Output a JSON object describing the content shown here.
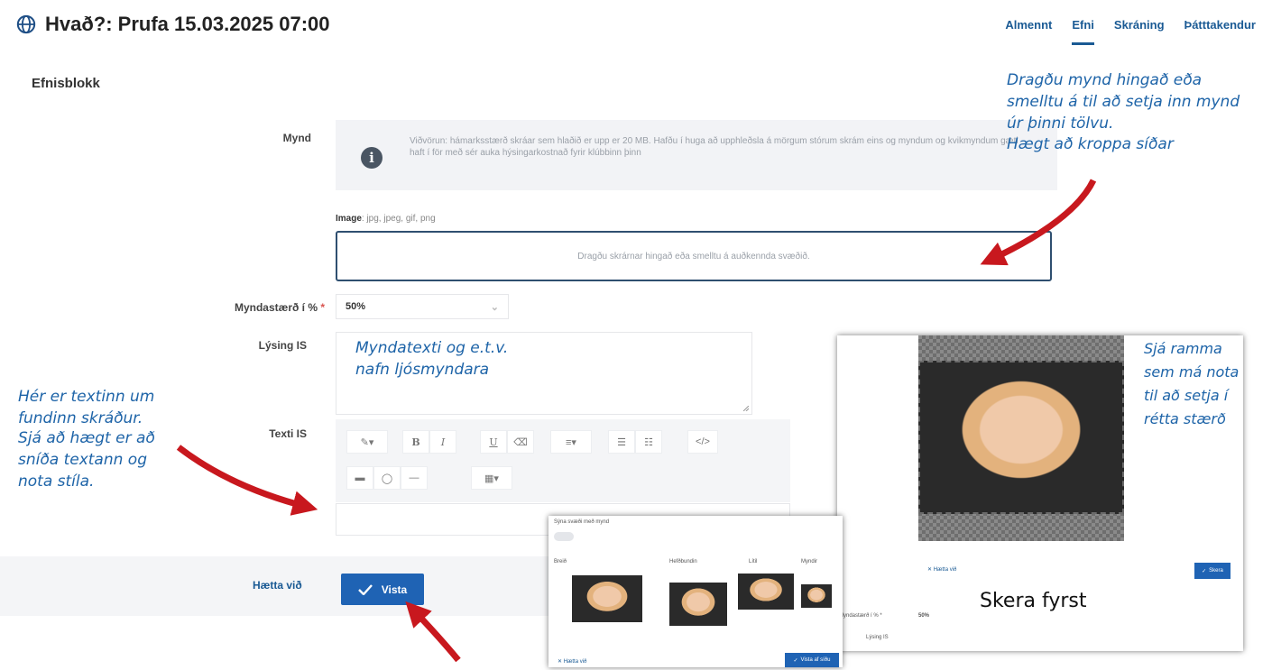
{
  "header": {
    "title": "Hvað?: Prufa 15.03.2025 07:00",
    "tabs": [
      {
        "label": "Almennt",
        "active": false
      },
      {
        "label": "Efni",
        "active": true
      },
      {
        "label": "Skráning",
        "active": false
      },
      {
        "label": "Þátttakendur",
        "active": false
      }
    ]
  },
  "section": {
    "title": "Efnisblokk"
  },
  "form": {
    "image_label": "Mynd",
    "info_text": "Viðvörun: hámarksstærð skráar sem hlaðið er upp er 20 MB. Hafðu í huga að upphleðsla á mörgum stórum skrám eins og myndum og kvikmyndum gæti haft í för með sér auka hýsingarkostnað fyrir klúbbinn þinn",
    "image_types_label": "Image",
    "image_types": ": jpg, jpeg, gif, png",
    "dropzone_text": "Dragðu skrárnar hingað eða smelltu á auðkennda svæðið.",
    "size_label": "Myndastærð í %",
    "size_required": "*",
    "size_value": "50%",
    "description_label": "Lýsing IS",
    "text_label": "Texti IS",
    "toolbar": [
      "B",
      "I",
      "U",
      "</>"
    ]
  },
  "footer": {
    "cancel_label": "Hætta við",
    "save_label": "Vista"
  },
  "annotations": {
    "drag_hint": "Dragðu mynd hingað eða smelltu á til að setja inn mynd úr þinni tölvu.",
    "crop_hint": "Hægt að kroppa síðar",
    "caption_hint_1": "Myndatexti og e.t.v.",
    "caption_hint_2": "nafn ljósmyndara",
    "text_hint_1": "Hér er textinn um fundinn skráður.",
    "text_hint_2": "Sjá að hægt er að sníða textann og nota stíla.",
    "frame_hint": "Sjá ramma sem má nota til að setja í rétta stærð",
    "crop_first": "Skera fyrst"
  },
  "crop_panel": {
    "cancel_label": "Hætta við",
    "crop_label": "Skera",
    "size_label": "Myndastærð í % *",
    "size_value": "50%",
    "description_label": "Lýsing IS"
  },
  "preview_panel": {
    "title": "Sýna svæði með mynd",
    "columns": [
      "Breið",
      "Hefðbundin",
      "Lítil",
      "Myndir"
    ],
    "cancel_label": "Hætta við",
    "save_label": "Vista af síðu"
  },
  "colors": {
    "accent": "#1f63b4",
    "annotation": "#1e64a8",
    "arrow": "#c8181e"
  }
}
